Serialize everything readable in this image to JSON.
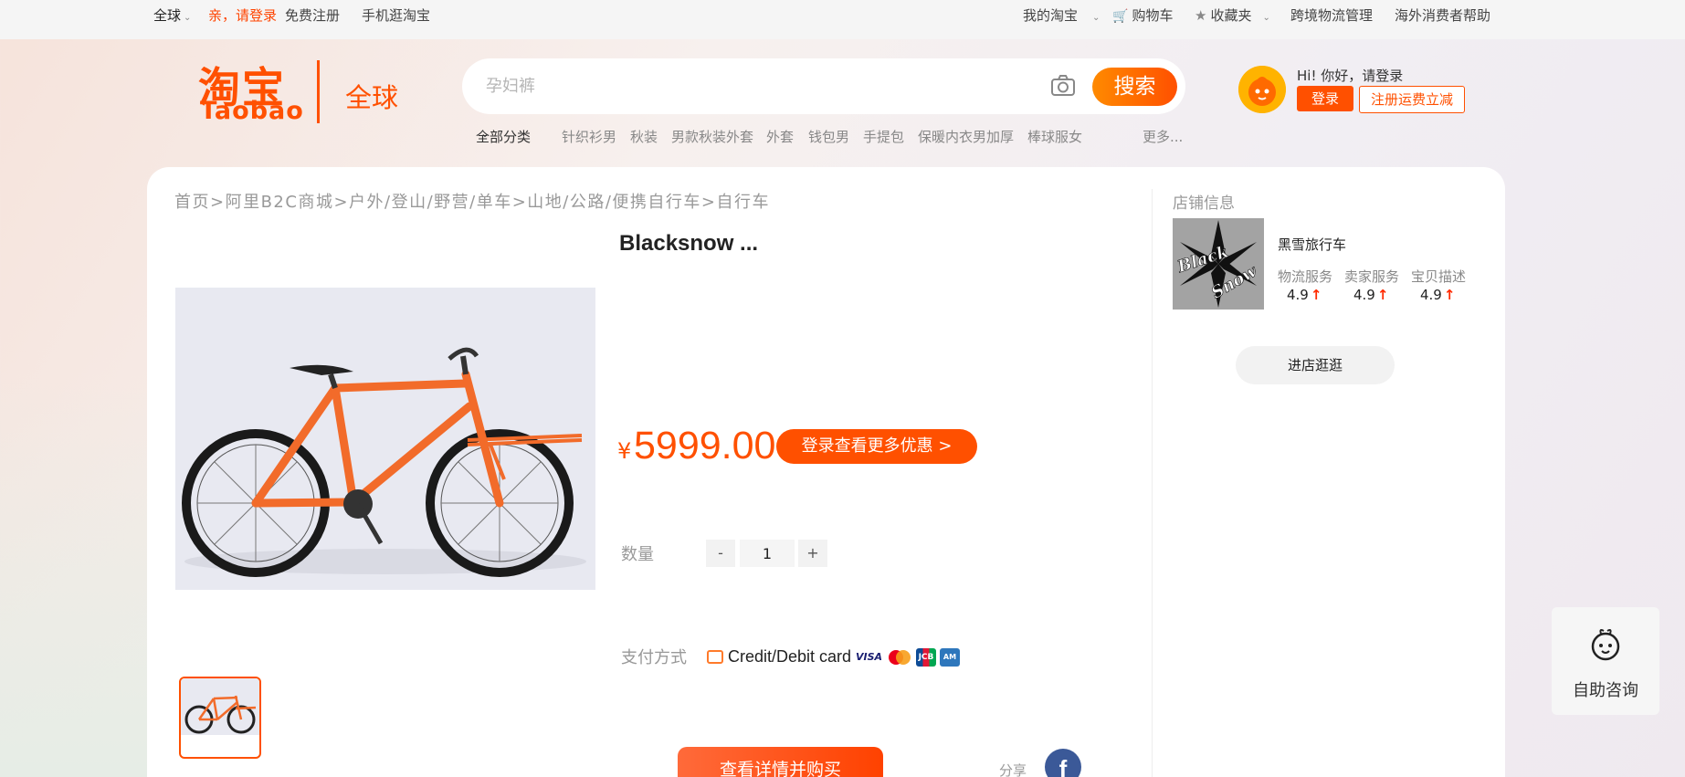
{
  "topbar": {
    "region": "全球",
    "login_prompt": "亲，请登录",
    "register": "免费注册",
    "mobile": "手机逛淘宝",
    "my_taobao": "我的淘宝",
    "cart": "购物车",
    "favorites": "收藏夹",
    "logistics": "跨境物流管理",
    "help": "海外消费者帮助"
  },
  "logo": {
    "cn": "淘宝",
    "en": "Taobao",
    "global": "全球"
  },
  "search": {
    "placeholder": "孕妇裤",
    "button": "搜索"
  },
  "hot_words": {
    "all": "全部分类",
    "items": [
      "针织衫男",
      "秋装",
      "男款秋装外套",
      "外套",
      "钱包男",
      "手提包",
      "保暖内衣男加厚",
      "棒球服女"
    ],
    "more": "更多..."
  },
  "user": {
    "greeting": "Hi! 你好，请登录",
    "login": "登录",
    "register": "注册运费立减"
  },
  "breadcrumb": "首页>阿里B2C商城>户外/登山/野营/单车>山地/公路/便携自行车>自行车",
  "product": {
    "title": "Blacksnow ...",
    "currency": "¥",
    "price": "5999.00",
    "promo": "登录查看更多优惠 >",
    "quantity_label": "数量",
    "quantity": "1",
    "minus": "-",
    "plus": "+",
    "payment_label": "支付方式",
    "payment_method": "Credit/Debit card",
    "buy": "查看详情并购买",
    "share": "分享"
  },
  "shop": {
    "section_title": "店铺信息",
    "name": "黑雪旅行车",
    "logo_text_1": "Black",
    "logo_text_2": "Snow",
    "ratings": [
      {
        "label": "物流服务",
        "value": "4.9"
      },
      {
        "label": "卖家服务",
        "value": "4.9"
      },
      {
        "label": "宝贝描述",
        "value": "4.9"
      }
    ],
    "enter": "进店逛逛"
  },
  "help_widget": {
    "label": "自助咨询"
  },
  "colors": {
    "brand": "#ff5000",
    "rating_up": "#ff2a00"
  }
}
